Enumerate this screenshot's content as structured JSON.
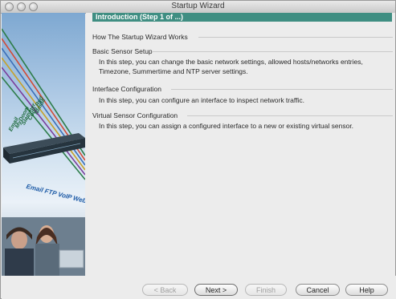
{
  "window": {
    "title": "Startup Wizard"
  },
  "step": {
    "title": "Introduction (Step 1 of ...)"
  },
  "sections": [
    {
      "heading": "How The Startup Wizard Works",
      "body": ""
    },
    {
      "heading": "Basic Sensor Setup",
      "body": "In this step, you can change the basic network settings, allowed hosts/networks entries, Timezone, Summertime and NTP server settings."
    },
    {
      "heading": "Interface Configuration",
      "body": "In this step, you can configure an interface to inspect network traffic."
    },
    {
      "heading": "Virtual Sensor Configuration",
      "body": "In this step, you can assign a configured interface to a new or existing virtual sensor."
    }
  ],
  "sidebar": {
    "words": [
      "Nimda",
      "Code Red",
      "Slammer",
      "MyDoom",
      "Email"
    ],
    "apps": "Email FTP VoIP Web Pages"
  },
  "buttons": {
    "back": "< Back",
    "next": "Next >",
    "finish": "Finish",
    "cancel": "Cancel",
    "help": "Help"
  },
  "colors": {
    "banner": "#3f8e82"
  }
}
